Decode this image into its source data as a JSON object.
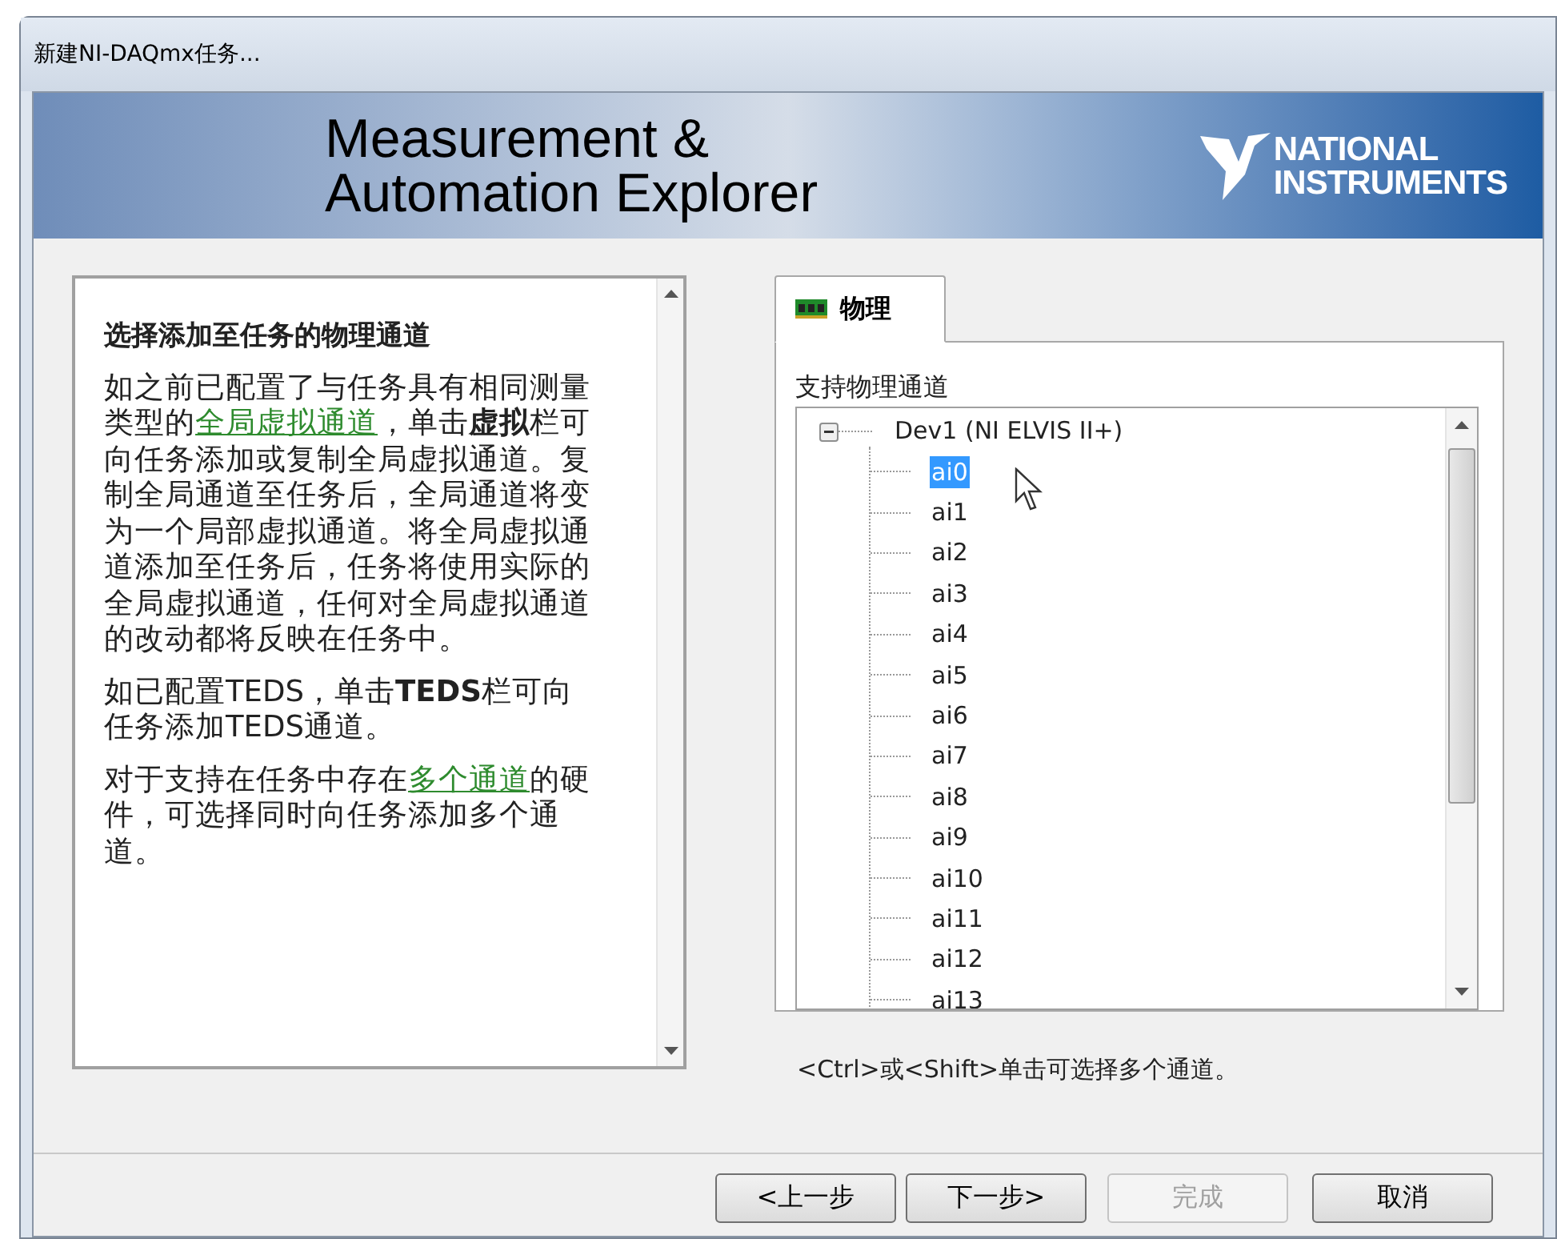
{
  "window": {
    "title": "新建NI-DAQmx任务..."
  },
  "banner": {
    "title_lines": [
      "Measurement &",
      "Automation Explorer"
    ],
    "logo_lines": [
      "NATIONAL",
      "INSTRUMENTS"
    ]
  },
  "help": {
    "heading": "选择添加至任务的物理通道",
    "paragraphs": [
      [
        {
          "kind": "text",
          "text": "如之前已配置了与任务具有相同测量类型的"
        },
        {
          "kind": "link",
          "text": "全局虚拟通道"
        },
        {
          "kind": "text",
          "text": "，单击**虚拟**栏可向任务添加或复制全局虚拟通道。复制全局通道至任务后，全局通道将变为一个局部虚拟通道。将全局虚拟通道添加至任务后，任务将使用实际的全局虚拟通道，任何对全局虚拟通道的改动都将反映在任务中。"
        }
      ],
      [
        {
          "kind": "text",
          "text": "如已配置TEDS，单击**TEDS**栏可向任务添加TEDS通道。"
        }
      ],
      [
        {
          "kind": "text",
          "text": "对于支持在任务中存在"
        },
        {
          "kind": "link",
          "text": "多个通道"
        },
        {
          "kind": "text",
          "text": "的硬件，可选择同时向任务添加多个通道。"
        }
      ]
    ]
  },
  "tabs": [
    {
      "label": "物理",
      "selected": true
    }
  ],
  "channels": {
    "label": "支持物理通道",
    "tree": [
      {
        "label": "Dev1  (NI ELVIS II+)",
        "expanded": true,
        "children": [
          {
            "label": "ai0",
            "selected": true
          },
          {
            "label": "ai1",
            "selected": false
          },
          {
            "label": "ai2",
            "selected": false
          },
          {
            "label": "ai3",
            "selected": false
          },
          {
            "label": "ai4",
            "selected": false
          },
          {
            "label": "ai5",
            "selected": false
          },
          {
            "label": "ai6",
            "selected": false
          },
          {
            "label": "ai7",
            "selected": false
          },
          {
            "label": "ai8",
            "selected": false
          },
          {
            "label": "ai9",
            "selected": false
          },
          {
            "label": "ai10",
            "selected": false
          },
          {
            "label": "ai11",
            "selected": false
          },
          {
            "label": "ai12",
            "selected": false
          },
          {
            "label": "ai13",
            "selected": false
          }
        ]
      }
    ]
  },
  "hint": "<Ctrl>或<Shift>单击可选择多个通道。",
  "buttons": [
    {
      "label": "<上一步",
      "disabled": false
    },
    {
      "label": "下一步>",
      "disabled": false
    },
    {
      "label": "完成",
      "disabled": true
    },
    {
      "label": "取消",
      "disabled": false
    }
  ]
}
